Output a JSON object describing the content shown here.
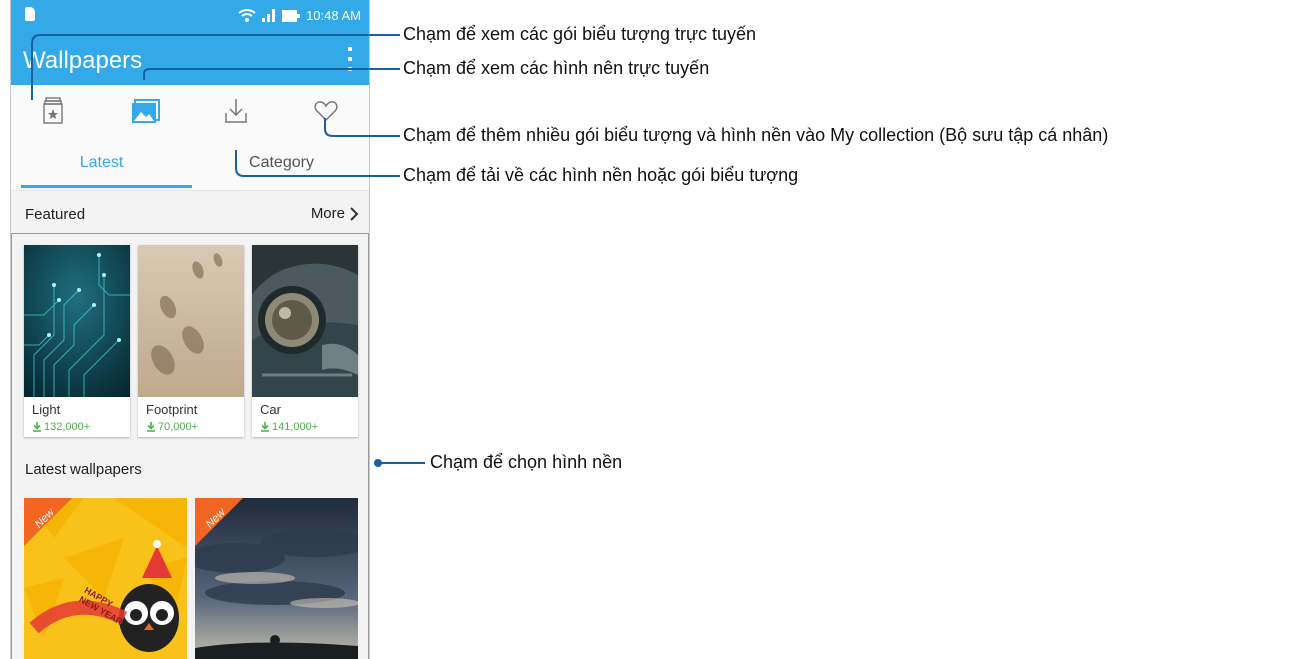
{
  "status_bar": {
    "time": "10:48 AM"
  },
  "app_bar": {
    "title": "Wallpapers"
  },
  "tabs": [
    {
      "label": "Latest"
    },
    {
      "label": "Category"
    }
  ],
  "featured": {
    "label": "Featured",
    "more_label": "More",
    "items": [
      {
        "name": "Light",
        "downloads": "132,000+"
      },
      {
        "name": "Footprint",
        "downloads": "70,000+"
      },
      {
        "name": "Car",
        "downloads": "141,000+"
      }
    ]
  },
  "latest": {
    "label": "Latest wallpapers",
    "badge": "New",
    "greeting_line1": "HAPPY",
    "greeting_line2": "NEW YEAR"
  },
  "callouts": {
    "icon_packs": "Chạm để xem các gói biểu tượng trực tuyến",
    "wallpapers": "Chạm để xem các hình nên trực tuyến",
    "collection": "Chạm để thêm nhiều gói biểu tượng và hình nền vào My collection (Bộ sưu tập cá nhân)",
    "download": "Chạm để tải về các hình nền hoặc gói biểu tượng",
    "select": "Chạm để chọn hình nền"
  },
  "colors": {
    "accent": "#33a9e8",
    "download_green": "#4caf50",
    "callout_line": "#1a5fa0"
  }
}
